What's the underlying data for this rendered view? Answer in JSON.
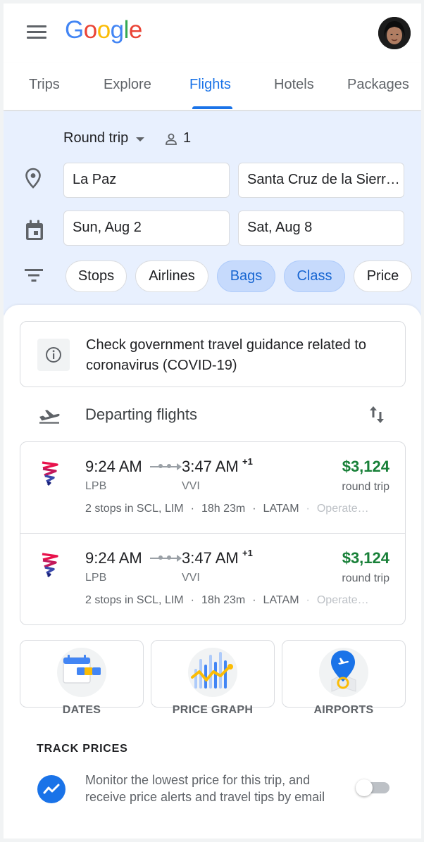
{
  "header": {
    "logo_letters": [
      {
        "ch": "G",
        "color": "#4285F4"
      },
      {
        "ch": "o",
        "color": "#EA4335"
      },
      {
        "ch": "o",
        "color": "#FBBC05"
      },
      {
        "ch": "g",
        "color": "#4285F4"
      },
      {
        "ch": "l",
        "color": "#34A853"
      },
      {
        "ch": "e",
        "color": "#EA4335"
      }
    ],
    "menu_icon": "hamburger-menu-icon",
    "avatar_icon": "user-avatar"
  },
  "tabs": [
    {
      "label": "Trips",
      "active": false
    },
    {
      "label": "Explore",
      "active": false
    },
    {
      "label": "Flights",
      "active": true
    },
    {
      "label": "Hotels",
      "active": false
    },
    {
      "label": "Packages",
      "active": false
    }
  ],
  "search": {
    "trip_type": "Round trip",
    "passengers": "1",
    "origin": "La Paz",
    "destination": "Santa Cruz de la Sierr…",
    "depart_date": "Sun, Aug 2",
    "return_date": "Sat, Aug 8",
    "filters": [
      {
        "label": "Stops",
        "selected": false
      },
      {
        "label": "Airlines",
        "selected": false
      },
      {
        "label": "Bags",
        "selected": true
      },
      {
        "label": "Class",
        "selected": true
      },
      {
        "label": "Price",
        "selected": false
      }
    ]
  },
  "covid_notice": {
    "text": "Check government travel guidance related to coronavirus (COVID-19)",
    "icon": "info-icon"
  },
  "departing": {
    "title": "Departing flights",
    "icon": "flight-takeoff-icon",
    "sort_icon": "swap-vert-icon"
  },
  "flights": [
    {
      "dep_time": "9:24 AM",
      "arr_time": "3:47 AM",
      "day_offset": "+1",
      "dep_code": "LPB",
      "arr_code": "VVI",
      "price": "$3,124",
      "price_type": "round trip",
      "stops": "2 stops in SCL, LIM",
      "duration": "18h 23m",
      "airline": "LATAM",
      "operated": "Operate…"
    },
    {
      "dep_time": "9:24 AM",
      "arr_time": "3:47 AM",
      "day_offset": "+1",
      "dep_code": "LPB",
      "arr_code": "VVI",
      "price": "$3,124",
      "price_type": "round trip",
      "stops": "2 stops in SCL, LIM",
      "duration": "18h 23m",
      "airline": "LATAM",
      "operated": "Operate…"
    }
  ],
  "tools": [
    {
      "label": "DATES",
      "icon": "calendar-dates-icon"
    },
    {
      "label": "PRICE GRAPH",
      "icon": "price-graph-icon"
    },
    {
      "label": "AIRPORTS",
      "icon": "airport-map-pin-icon"
    }
  ],
  "track_prices": {
    "title": "TRACK PRICES",
    "text": "Monitor the lowest price for this trip, and receive price alerts and travel tips by email",
    "enabled": false,
    "icon": "trending-icon"
  },
  "colors": {
    "accent": "#1a73e8",
    "price_green": "#188038",
    "search_bg": "#e8f0fe",
    "chip_selected": "#c6dafc"
  }
}
